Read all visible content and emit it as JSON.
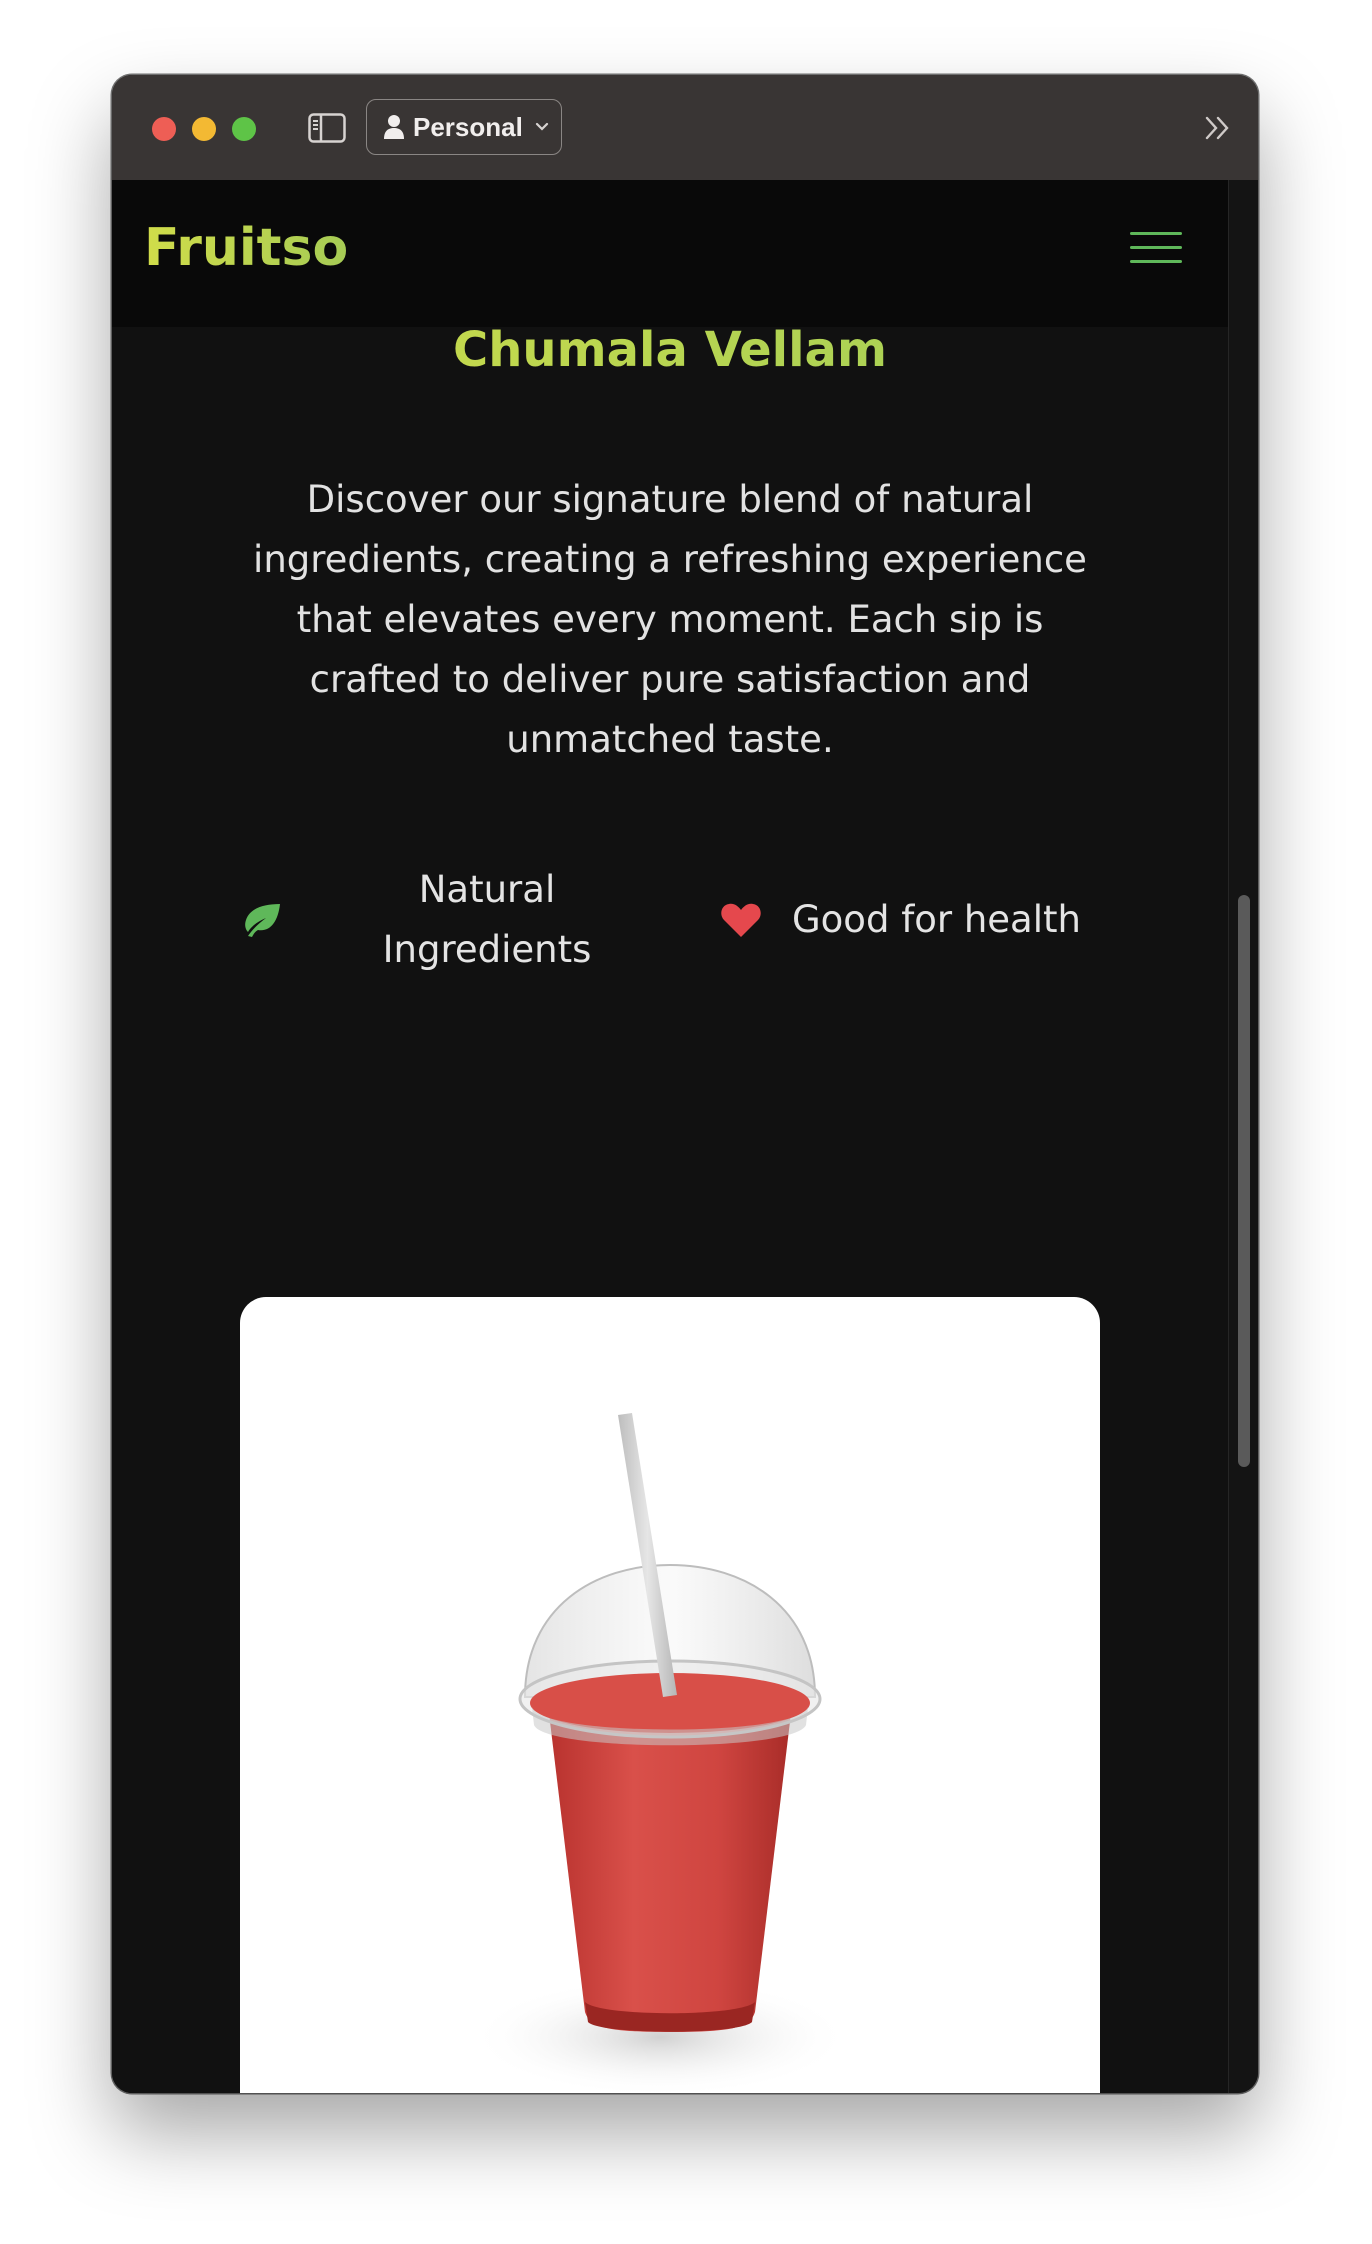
{
  "browser": {
    "profile_label": "Personal",
    "icons": [
      "sidebar-toggle-icon",
      "person-icon",
      "chevron-down-icon",
      "double-chevron-right-icon"
    ]
  },
  "site": {
    "brand": "Fruitso",
    "menu_icon": "hamburger-menu-icon",
    "brand_color": "#c4d84d",
    "accent_green": "#5fb85a"
  },
  "product": {
    "title": "Chumala Vellam",
    "description": "Discover our signature blend of natural ingredients, creating a refreshing experience that elevates every moment. Each sip is crafted to deliver pure satisfaction and unmatched taste.",
    "features": [
      {
        "label": "Natural Ingredients",
        "icon": "leaf-icon",
        "color": "#5fb85a"
      },
      {
        "label": "Good for health",
        "icon": "heart-icon",
        "color": "#e5484d"
      }
    ],
    "image_alt_icon": "red-juice-cup-image"
  }
}
